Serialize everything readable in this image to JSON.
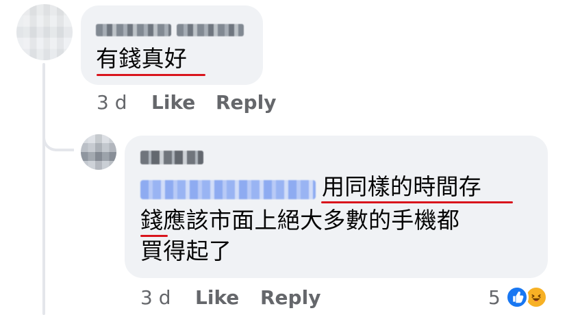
{
  "comments": {
    "main": {
      "text": "有錢真好",
      "timestamp": "3 d",
      "like_label": "Like",
      "reply_label": "Reply"
    },
    "reply": {
      "line_1": "用同樣的時間存",
      "line_2": "錢應該市面上絕大多數的手機都",
      "line_3": "買得起了",
      "timestamp": "3 d",
      "like_label": "Like",
      "reply_label": "Reply",
      "reaction_count": "5",
      "reaction_icons": [
        "like-icon",
        "haha-icon"
      ]
    }
  },
  "colors": {
    "bubble": "#f0f2f5",
    "meta_text": "#65676b",
    "body_text": "#050505",
    "underline": "#d9141c",
    "like_blue": "#1877f2",
    "haha_yellow": "#f7b125"
  }
}
